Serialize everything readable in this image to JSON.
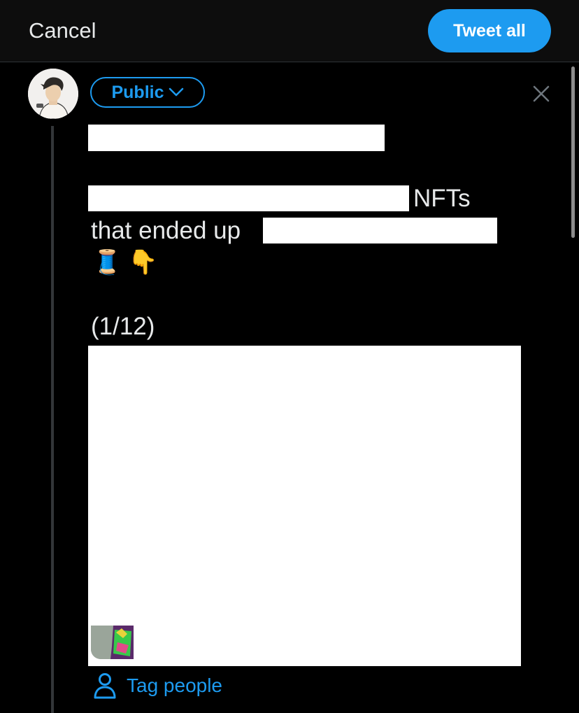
{
  "header": {
    "cancel_label": "Cancel",
    "tweet_all_label": "Tweet all"
  },
  "composer": {
    "audience_label": "Public",
    "text_line1_tail": "NFTs",
    "text_line2_head": "that ended up",
    "emojis": [
      "🧵",
      "👇"
    ],
    "thread_counter": "(1/12)"
  },
  "actions": {
    "tag_people_label": "Tag people"
  },
  "colors": {
    "accent": "#1d9bf0",
    "background": "#000000",
    "text": "#e7e9ea"
  },
  "icons": {
    "close": "close-icon",
    "chevron": "chevron-down-icon",
    "person": "person-icon"
  }
}
